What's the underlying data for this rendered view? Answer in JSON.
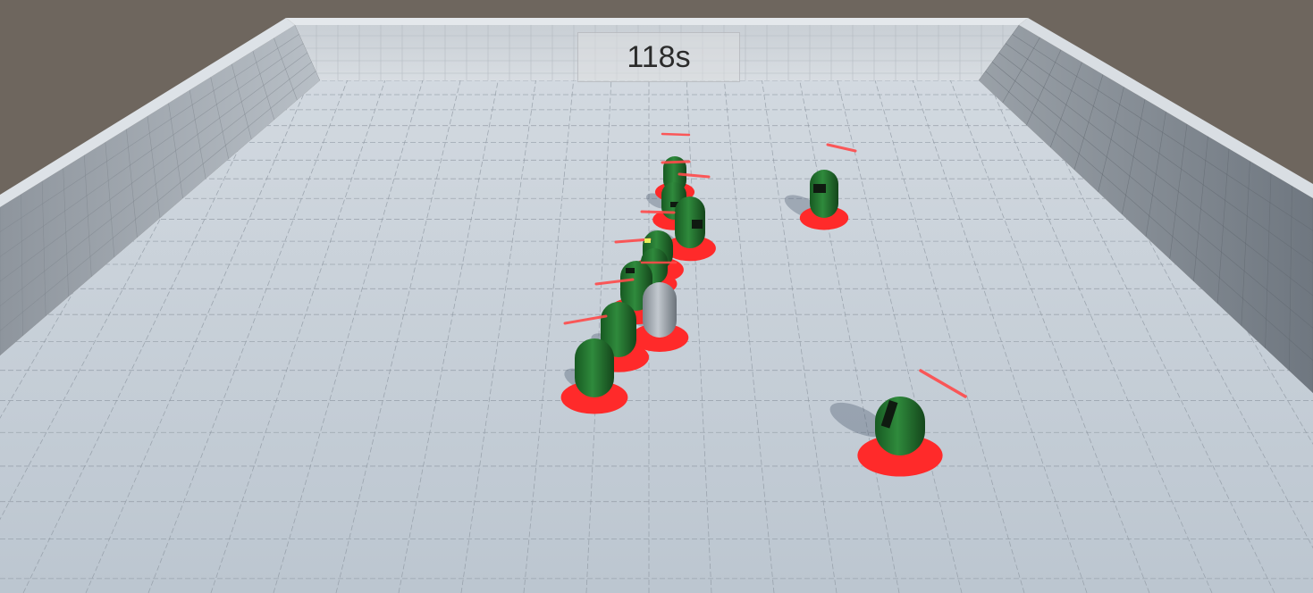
{
  "hud": {
    "timer": "118s"
  },
  "scene": {
    "sky_color": "#6e665e",
    "floor_color": "#c3ccd6",
    "grid_line_color": "#8f98a2",
    "wall_top_color": "#e2e7ec",
    "unit_color": "#2b7a36",
    "player_color": "#9aa2aa",
    "base_ring_color": "#ff2a2a",
    "aim_line_color": "#ff4a4a",
    "enemy_count": 10,
    "player_count": 1
  }
}
